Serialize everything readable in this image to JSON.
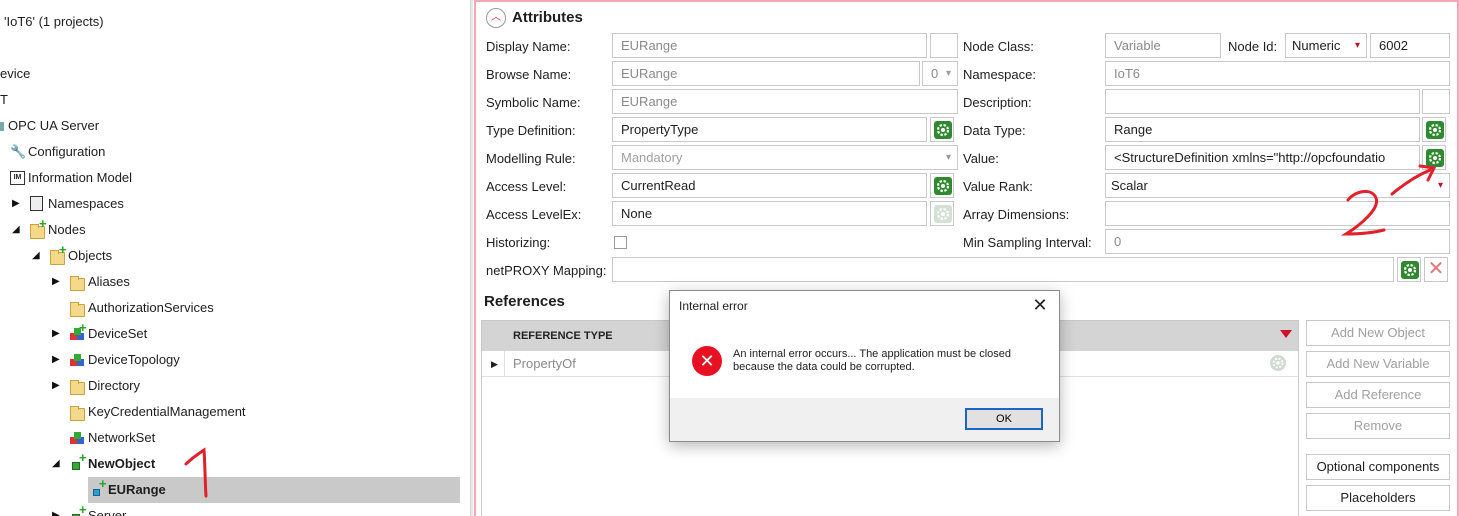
{
  "tree": {
    "items": [
      {
        "label": "'IoT6' (1 projects)",
        "icon": "none",
        "expander": ""
      },
      {
        "label": "evice",
        "icon": "none",
        "expander": ""
      },
      {
        "label": "T",
        "icon": "none",
        "expander": ""
      },
      {
        "label": "OPC UA Server",
        "icon": "none",
        "expander": ""
      },
      {
        "label": "Configuration",
        "icon": "wrench-icon",
        "expander": ""
      },
      {
        "label": "Information Model",
        "icon": "information-model-icon",
        "expander": ""
      },
      {
        "label": "Namespaces",
        "icon": "namespaces-icon",
        "expander": "▶"
      },
      {
        "label": "Nodes",
        "icon": "folder-plus-icon",
        "expander": "◢"
      },
      {
        "label": "Objects",
        "icon": "folder-plus-icon",
        "expander": "◢"
      },
      {
        "label": "Aliases",
        "icon": "folder-icon",
        "expander": "▶"
      },
      {
        "label": "AuthorizationServices",
        "icon": "folder-icon",
        "expander": ""
      },
      {
        "label": "DeviceSet",
        "icon": "object-cubes-icon",
        "expander": "▶"
      },
      {
        "label": "DeviceTopology",
        "icon": "object-cubes-icon",
        "expander": "▶"
      },
      {
        "label": "Directory",
        "icon": "folder-icon",
        "expander": "▶"
      },
      {
        "label": "KeyCredentialManagement",
        "icon": "folder-icon",
        "expander": ""
      },
      {
        "label": "NetworkSet",
        "icon": "object-cubes-icon",
        "expander": ""
      },
      {
        "label": "NewObject",
        "icon": "object-plus-icon",
        "expander": "◢"
      },
      {
        "label": "EURange",
        "icon": "property-plus-icon",
        "expander": ""
      },
      {
        "label": "Server",
        "icon": "object-plus-icon",
        "expander": "▶"
      }
    ]
  },
  "attributes": {
    "title": "Attributes",
    "display_name": {
      "label": "Display Name:",
      "value": "EURange"
    },
    "browse_name": {
      "label": "Browse Name:",
      "value": "EURange",
      "ns_index": "0"
    },
    "symbolic_name": {
      "label": "Symbolic Name:",
      "value": "EURange"
    },
    "type_definition": {
      "label": "Type Definition:",
      "value": "PropertyType"
    },
    "modelling_rule": {
      "label": "Modelling Rule:",
      "value": "Mandatory"
    },
    "access_level": {
      "label": "Access Level:",
      "value": "CurrentRead"
    },
    "access_level_ex": {
      "label": "Access LevelEx:",
      "value": "None"
    },
    "historizing": {
      "label": "Historizing:",
      "checked": false
    },
    "netproxy_mapping": {
      "label": "netPROXY Mapping:",
      "value": ""
    },
    "node_class": {
      "label": "Node Class:",
      "value": "Variable"
    },
    "node_id": {
      "label": "Node Id:",
      "type": "Numeric",
      "value": "6002"
    },
    "namespace": {
      "label": "Namespace:",
      "value": "IoT6"
    },
    "description": {
      "label": "Description:",
      "value": ""
    },
    "data_type": {
      "label": "Data Type:",
      "value": "Range"
    },
    "value": {
      "label": "Value:",
      "value": "<StructureDefinition xmlns=\"http://opcfoundatio"
    },
    "value_rank": {
      "label": "Value Rank:",
      "value": "Scalar"
    },
    "array_dimensions": {
      "label": "Array Dimensions:",
      "value": ""
    },
    "min_sampling_interval": {
      "label": "Min Sampling Interval:",
      "value": "0"
    }
  },
  "references": {
    "title": "References",
    "column": "REFERENCE TYPE",
    "rows": [
      {
        "value": "PropertyOf"
      }
    ],
    "buttons": {
      "add_object": "Add New Object",
      "add_variable": "Add New Variable",
      "add_reference": "Add Reference",
      "remove": "Remove",
      "optional_components": "Optional components",
      "placeholders": "Placeholders"
    }
  },
  "dialog": {
    "title": "Internal error",
    "message": "An internal error occurs... The application must be closed because the data could be corrupted.",
    "ok": "OK"
  },
  "annotations": {
    "one": "1",
    "two": "2"
  },
  "colors": {
    "selection": "#c9c9c9",
    "error_red": "#e81123",
    "accent_pink": "#f4a7b4",
    "gear_green": "#2f8a2f"
  }
}
